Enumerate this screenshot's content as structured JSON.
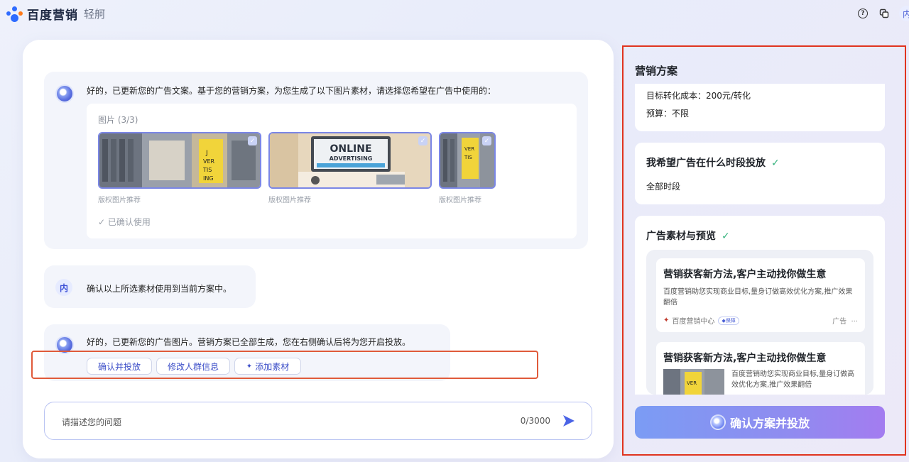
{
  "header": {
    "brand": "百度营销",
    "sub_brand": "轻舸",
    "avatar": "内"
  },
  "chat": {
    "bot_msg1": "好的，已更新您的广告文案。基于您的营销方案，为您生成了以下图片素材，请选择您希望在广告中使用的：",
    "assets": {
      "title": "图片 (3/3)",
      "thumbs": [
        {
          "caption": "版权图片推荐",
          "alt": "广告牌街景图"
        },
        {
          "caption": "版权图片推荐",
          "alt": "ONLINE ADVERTISING 图"
        },
        {
          "caption": "版权图片推荐",
          "alt": "广告牌小图"
        }
      ],
      "online_text": "ONLINE",
      "advertising_text": "ADVERTISING",
      "confirmed": "✓ 已确认使用"
    },
    "user_avatar": "内",
    "user_msg": "确认以上所选素材使用到当前方案中。",
    "bot_msg2": "好的，已更新您的广告图片。营销方案已全部生成，您在右侧确认后将为您开启投放。",
    "actions": {
      "confirm": "确认并投放",
      "edit_audience": "修改人群信息",
      "add_material": "添加素材"
    },
    "input": {
      "placeholder": "请描述您的问题",
      "counter": "0/3000"
    }
  },
  "plan": {
    "title": "营销方案",
    "goal_cost": "目标转化成本：200元/转化",
    "budget": "预算：不限",
    "schedule_title": "我希望广告在什么时段投放",
    "schedule_value": "全部时段",
    "preview_title": "广告素材与预览",
    "ad1": {
      "title": "营销获客新方法,客户主动找你做生意",
      "desc": "百度营销助您实现商业目标,量身订做高效优化方案,推广效果翻倍",
      "source": "百度营销中心",
      "badge": "保障",
      "tag": "广告",
      "more": "···"
    },
    "ad2": {
      "title": "营销获客新方法,客户主动找你做生意",
      "desc": "百度营销助您实现商业目标,量身订做高效优化方案,推广效果翻倍"
    },
    "confirm_button": "确认方案并投放"
  },
  "colors": {
    "accent": "#3d4fc8",
    "highlight_border": "#e0341f",
    "check": "#36b37e"
  }
}
